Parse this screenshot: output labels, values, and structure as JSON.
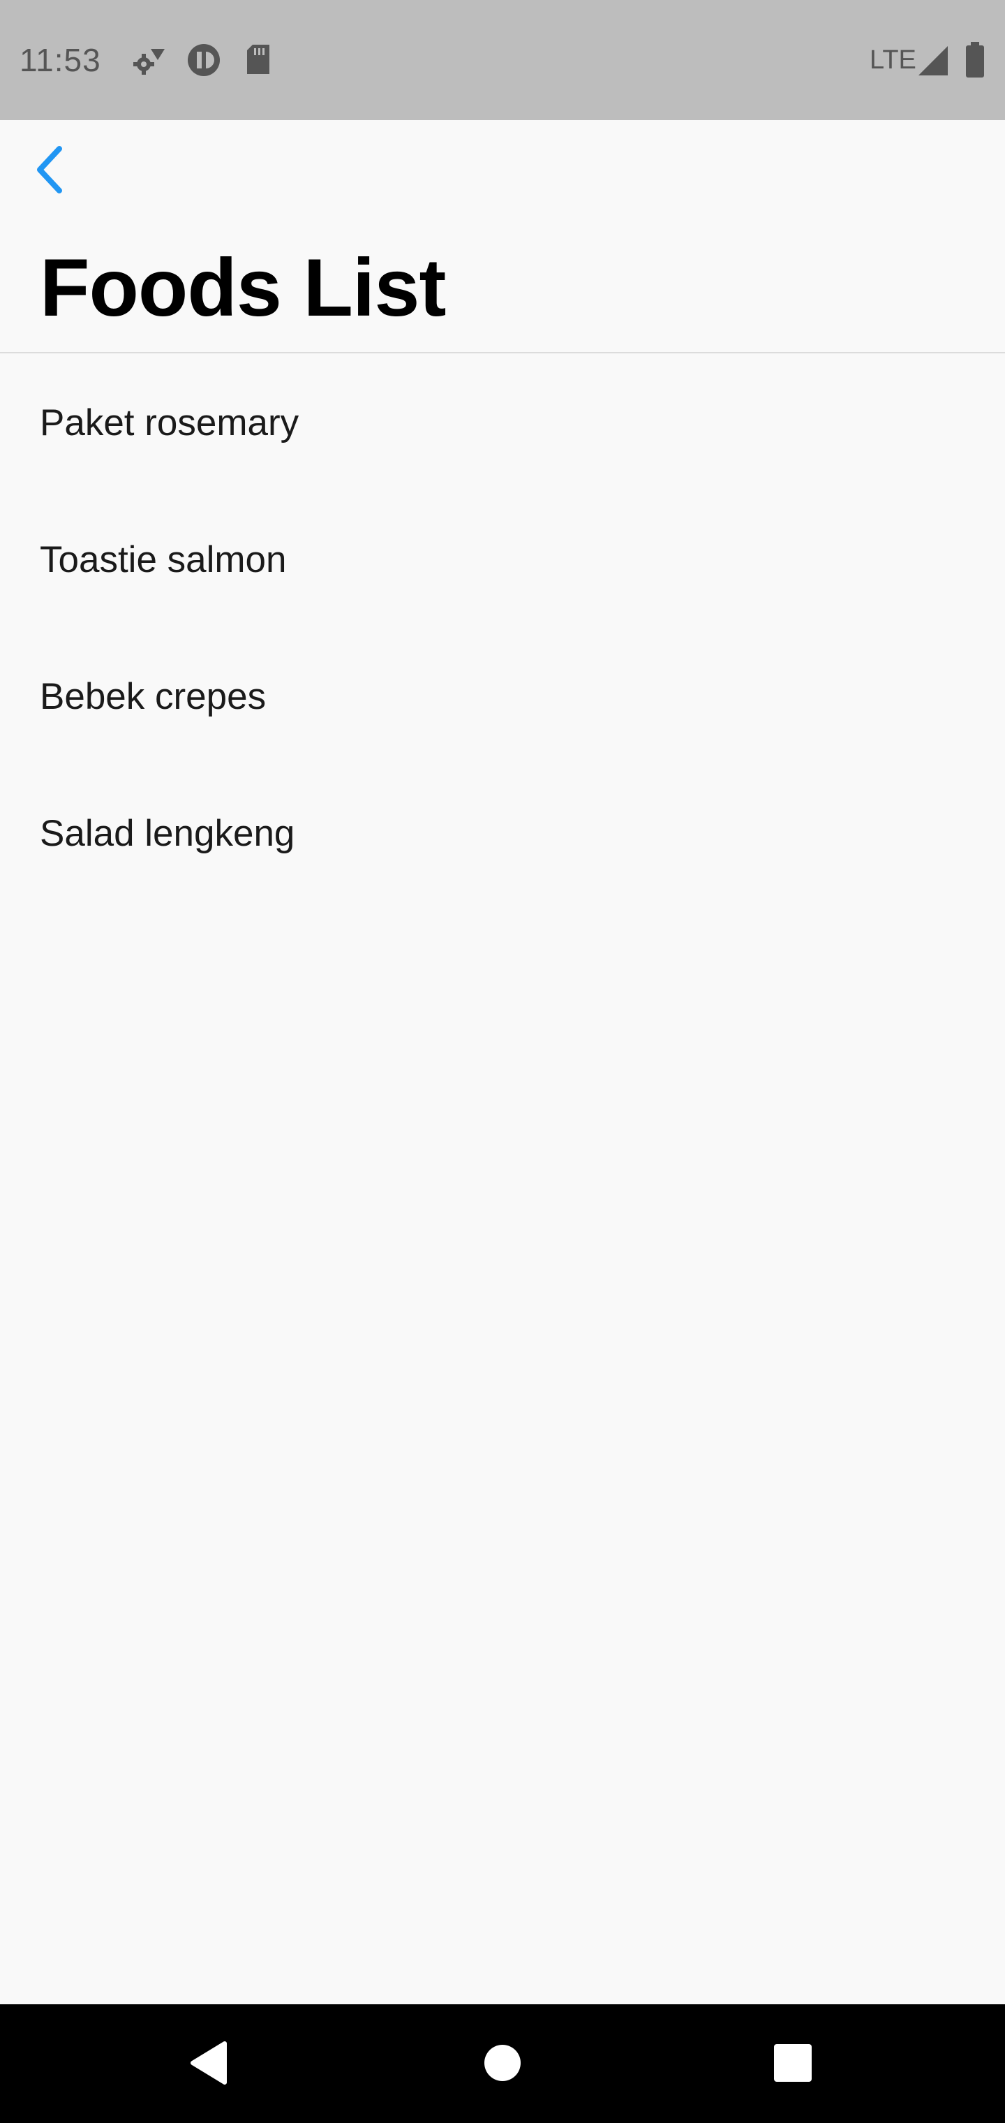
{
  "status_bar": {
    "time": "11:53",
    "network": "LTE",
    "icons": [
      "settings-sync-icon",
      "data-saver-icon",
      "sd-card-icon",
      "signal-icon",
      "battery-icon"
    ]
  },
  "header": {
    "back_icon": "chevron-left-icon",
    "title": "Foods List",
    "accent_color": "#2196F3"
  },
  "foods": [
    {
      "label": "Paket rosemary"
    },
    {
      "label": "Toastie salmon"
    },
    {
      "label": "Bebek crepes"
    },
    {
      "label": "Salad lengkeng"
    }
  ],
  "nav_bar": {
    "buttons": [
      "back-triangle-icon",
      "home-circle-icon",
      "recents-square-icon"
    ]
  }
}
